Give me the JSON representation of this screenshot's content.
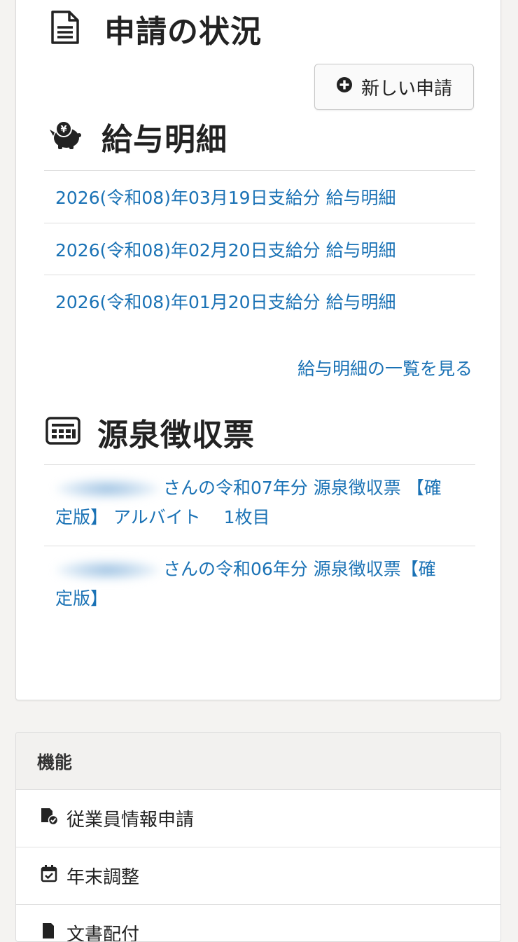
{
  "status_section": {
    "title": "申請の状況",
    "icon": "document-icon",
    "new_button_label": "新しい申請"
  },
  "payslip_section": {
    "title": "給与明細",
    "icon": "piggy-bank-yen-icon",
    "items": [
      "2026(令和08)年03月19日支給分 給与明細",
      "2026(令和08)年02月20日支給分 給与明細",
      "2026(令和08)年01月20日支給分 給与明細"
    ],
    "view_all_label": "給与明細の一覧を見る"
  },
  "withholding_section": {
    "title": "源泉徴収票",
    "icon": "receipt-icon",
    "items": [
      {
        "line1": "さんの令和07年分 源泉徴収票 【確",
        "line2": "定版】 アルバイト　 1枚目"
      },
      {
        "line1": "さんの令和06年分 源泉徴収票【確",
        "line2": "定版】"
      }
    ]
  },
  "features": {
    "header": "機能",
    "items": [
      {
        "label": "従業員情報申請",
        "icon": "employee-info-icon"
      },
      {
        "label": "年末調整",
        "icon": "calendar-check-icon"
      },
      {
        "label": "文書配付",
        "icon": "document-distribution-icon"
      }
    ]
  },
  "colors": {
    "link": "#1a72b5",
    "background": "#f4f3f1",
    "card": "#ffffff"
  }
}
